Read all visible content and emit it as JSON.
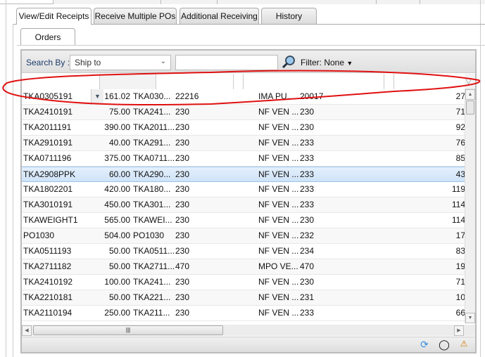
{
  "tabs": [
    {
      "label": "View/Edit Receipts",
      "active": true
    },
    {
      "label": "Receive Multiple POs"
    },
    {
      "label": "Additional Receiving"
    },
    {
      "label": "History"
    }
  ],
  "subtab": {
    "label": "Orders"
  },
  "toolbar": {
    "search_by_label": "Search By :",
    "search_by_value": "Ship to",
    "search_value": "",
    "filter_label": "Filter: None"
  },
  "rows": [
    [
      "TKA0305191",
      "161.02",
      "TKA030...",
      "22216",
      "IMA PU...",
      "20017",
      "27"
    ],
    [
      "TKA2410191",
      "75.00",
      "TKA241...",
      "230",
      "NF VEN ...",
      "230",
      "71"
    ],
    [
      "TKA2011191",
      "390.00",
      "TKA2011...",
      "230",
      "NF VEN ...",
      "230",
      "92"
    ],
    [
      "TKA2910191",
      "40.00",
      "TKA291...",
      "230",
      "NF VEN ...",
      "233",
      "76"
    ],
    [
      "TKA0711196",
      "375.00",
      "TKA0711...",
      "230",
      "NF VEN ...",
      "233",
      "85"
    ],
    [
      "TKA2908PPK",
      "60.00",
      "TKA290...",
      "230",
      "NF VEN ...",
      "233",
      "43"
    ],
    [
      "TKA1802201",
      "420.00",
      "TKA180...",
      "230",
      "NF VEN ...",
      "233",
      "119"
    ],
    [
      "TKA3010191",
      "450.00",
      "TKA301...",
      "230",
      "NF VEN ...",
      "233",
      "114"
    ],
    [
      "TKAWEIGHT1",
      "565.00",
      "TKAWEI...",
      "230",
      "NF VEN ...",
      "230",
      "114"
    ],
    [
      "PO1030",
      "504.00",
      "PO1030",
      "230",
      "NF VEN ...",
      "232",
      "17"
    ],
    [
      "TKA0511193",
      "50.00",
      "TKA0511...",
      "230",
      "NF VEN ...",
      "234",
      "83"
    ],
    [
      "TKA2711182",
      "50.00",
      "TKA2711...",
      "470",
      "MPO VE...",
      "470",
      "19"
    ],
    [
      "TKA2410192",
      "100.00",
      "TKA241...",
      "230",
      "NF VEN ...",
      "230",
      "71"
    ],
    [
      "TKA2210181",
      "50.00",
      "TKA221...",
      "230",
      "NF VEN ...",
      "231",
      "10"
    ],
    [
      "TKA2110194",
      "250.00",
      "TKA211...",
      "230",
      "NF VEN ...",
      "233",
      "66"
    ]
  ],
  "selected_row": 5,
  "footer_icons": [
    "refresh-icon",
    "binoculars-icon",
    "export-icon"
  ],
  "annotation_color": "#e01010"
}
